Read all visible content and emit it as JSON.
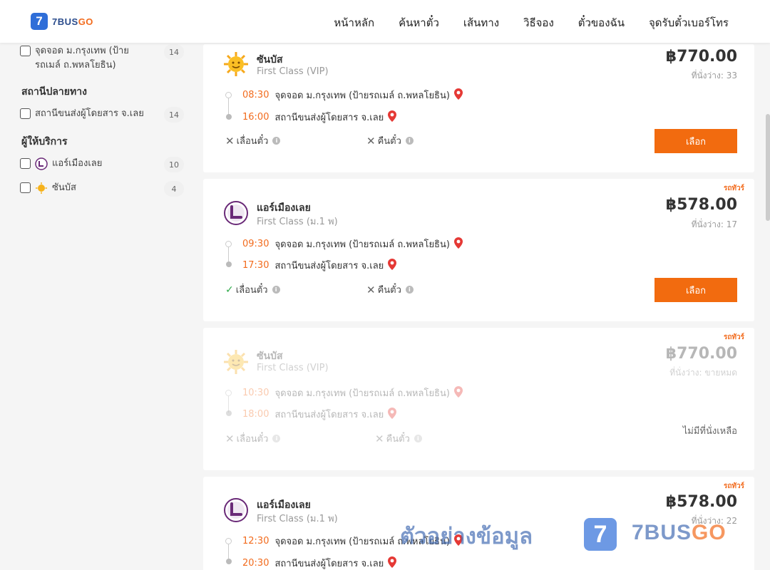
{
  "header": {
    "logo_mark": "7",
    "logo_name_a": "7BUS",
    "logo_name_b": "GO",
    "nav": [
      "หน้าหลัก",
      "ค้นหาตั๋ว",
      "เส้นทาง",
      "วิธีจอง",
      "ตั๋วของฉัน",
      "จุดรับตั๋วเบอร์โทร"
    ]
  },
  "sidebar": {
    "origin_item": {
      "label": "จุดจอด ม.กรุงเทพ (ป้ายรถเมล์ ถ.พหลโยธิน)",
      "count": "14"
    },
    "dest_title": "สถานีปลายทาง",
    "dest_item": {
      "label": "สถานีขนส่งผู้โดยสาร จ.เลย",
      "count": "14"
    },
    "operator_title": "ผู้ให้บริการ",
    "operators": [
      {
        "label": "แอร์เมืองเลย",
        "count": "10"
      },
      {
        "label": "ซันบัส",
        "count": "4"
      }
    ]
  },
  "trips": [
    {
      "operator": "ซันบัส",
      "class": "First Class (VIP)",
      "price": "฿770.00",
      "seats": "ที่นั่งว่าง: 33",
      "tag": "",
      "dep_time": "08:30",
      "dep_stop": "จุดจอด ม.กรุงเทพ (ป้ายรถเมล์ ถ.พหลโยธิน)",
      "arr_time": "16:00",
      "arr_stop": "สถานีขนส่งผู้โดยสาร จ.เลย",
      "policy_change": "เลื่อนตั๋ว",
      "policy_refund": "คืนตั๋ว",
      "action": "เลือก"
    },
    {
      "operator": "แอร์เมืองเลย",
      "class": "First Class (ม.1 พ)",
      "price": "฿578.00",
      "seats": "ที่นั่งว่าง: 17",
      "tag": "รถทัวร์",
      "dep_time": "09:30",
      "dep_stop": "จุดจอด ม.กรุงเทพ (ป้ายรถเมล์ ถ.พหลโยธิน)",
      "arr_time": "17:30",
      "arr_stop": "สถานีขนส่งผู้โดยสาร จ.เลย",
      "policy_change": "เลื่อนตั๋ว",
      "policy_refund": "คืนตั๋ว",
      "action": "เลือก"
    },
    {
      "operator": "ซันบัส",
      "class": "First Class (VIP)",
      "price": "฿770.00",
      "seats": "ที่นั่งว่าง: ขายหมด",
      "tag": "รถทัวร์",
      "dep_time": "10:30",
      "dep_stop": "จุดจอด ม.กรุงเทพ (ป้ายรถเมล์ ถ.พหลโยธิน)",
      "arr_time": "18:00",
      "arr_stop": "สถานีขนส่งผู้โดยสาร จ.เลย",
      "policy_change": "เลื่อนตั๋ว",
      "policy_refund": "คืนตั๋ว",
      "sold_out": "ไม่มีที่นั่งเหลือ"
    },
    {
      "operator": "แอร์เมืองเลย",
      "class": "First Class (ม.1 พ)",
      "price": "฿578.00",
      "seats": "ที่นั่งว่าง: 22",
      "tag": "รถทัวร์",
      "dep_time": "12:30",
      "dep_stop": "จุดจอด ม.กรุงเทพ (ป้ายรถเมล์ ถ.พหลโยธิน)",
      "arr_time": "20:30",
      "arr_stop": "สถานีขนส่งผู้โดยสาร จ.เลย"
    }
  ],
  "watermark": {
    "text": "ตัวอย่างข้อมูล",
    "mark": "7",
    "brand_a": "7BUS",
    "brand_b": "GO"
  },
  "colors": {
    "accent": "#f26b0f",
    "brand_blue": "#2f6ed8",
    "pin_red": "#e53935"
  }
}
